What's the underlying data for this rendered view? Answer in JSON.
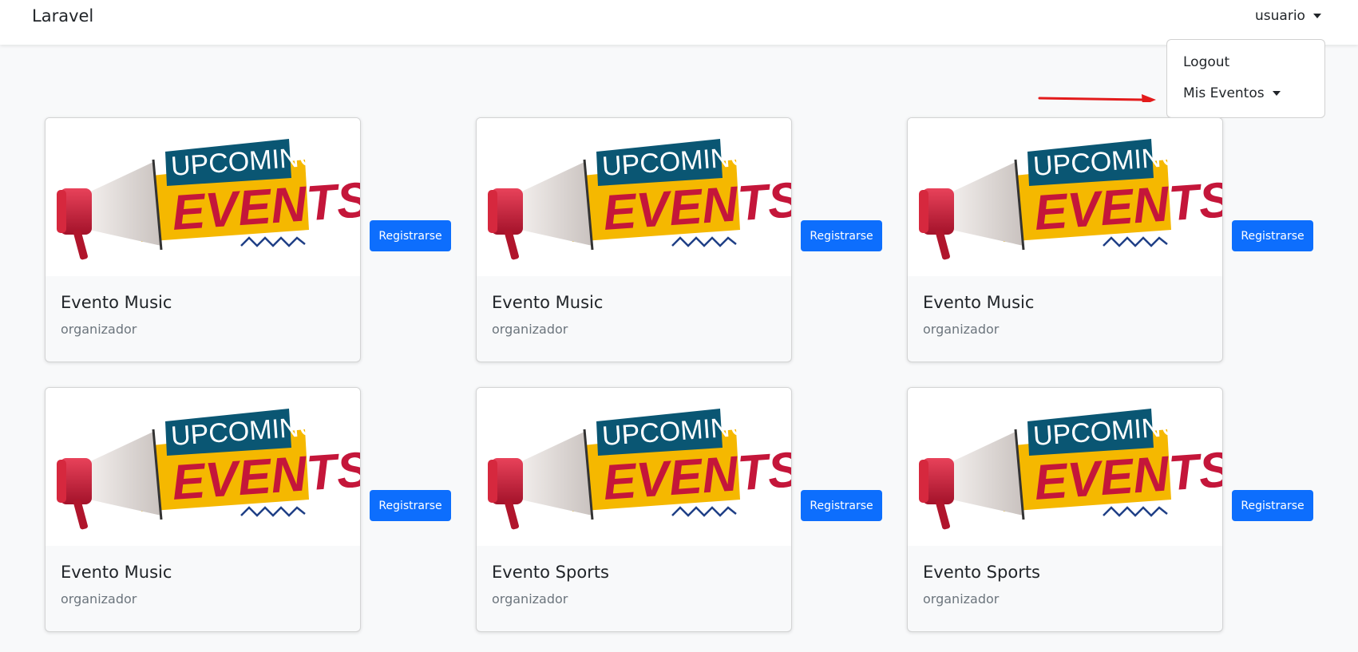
{
  "navbar": {
    "brand": "Laravel",
    "user_menu_label": "usuario"
  },
  "dropdown": {
    "items": [
      {
        "label": "Logout"
      },
      {
        "label": "Mis Eventos"
      }
    ]
  },
  "image_text": {
    "line1": "UPCOMING",
    "line2": "EVENTS"
  },
  "cards": [
    {
      "title": "Evento Music",
      "subtitle": "organizador",
      "button_label": "Registrarse"
    },
    {
      "title": "Evento Music",
      "subtitle": "organizador",
      "button_label": "Registrarse"
    },
    {
      "title": "Evento Music",
      "subtitle": "organizador",
      "button_label": "Registrarse"
    },
    {
      "title": "Evento Music",
      "subtitle": "organizador",
      "button_label": "Registrarse"
    },
    {
      "title": "Evento Sports",
      "subtitle": "organizador",
      "button_label": "Registrarse"
    },
    {
      "title": "Evento Sports",
      "subtitle": "organizador",
      "button_label": "Registrarse"
    }
  ],
  "colors": {
    "primary": "#0d6efd",
    "page_bg": "#f8f9fa",
    "annotation_arrow": "#e31b1b"
  }
}
